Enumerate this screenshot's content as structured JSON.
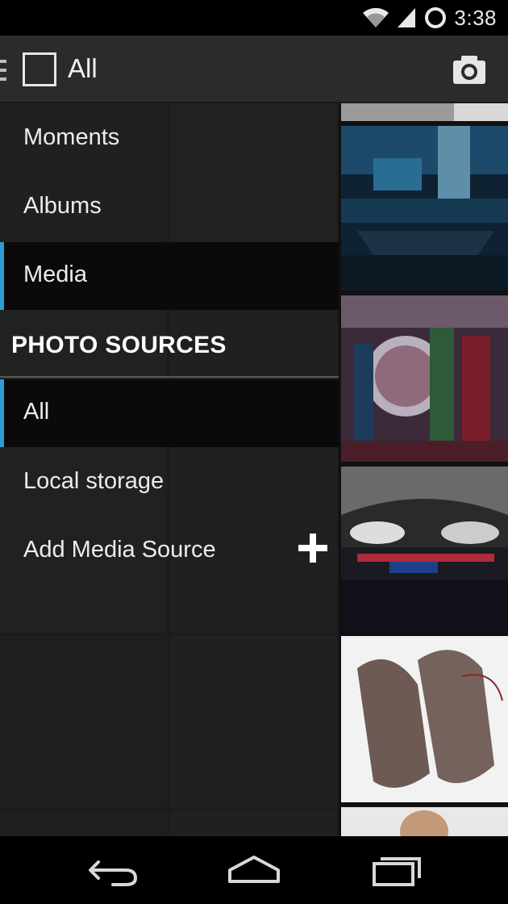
{
  "status_bar": {
    "time": "3:38",
    "icons": [
      "wifi-icon",
      "signal-icon",
      "battery-loading-icon"
    ]
  },
  "action_bar": {
    "title": "All",
    "icons": [
      "menu-icon",
      "app-icon",
      "camera-icon"
    ]
  },
  "drawer": {
    "items": [
      {
        "label": "Moments",
        "selected": false
      },
      {
        "label": "Albums",
        "selected": false
      },
      {
        "label": "Media",
        "selected": true
      }
    ],
    "section_header": "PHOTO SOURCES",
    "sources": [
      {
        "label": "All",
        "selected": true
      },
      {
        "label": "Local storage",
        "selected": false
      },
      {
        "label": "Add Media Source",
        "selected": false,
        "icon": "plus-icon"
      }
    ]
  },
  "colors": {
    "accent": "#2e9bd6",
    "drawer_bg": "#1e1e1e",
    "action_bar": "#2b2b2b"
  },
  "nav_bar": {
    "icons": [
      "back-icon",
      "home-icon",
      "recents-icon"
    ]
  }
}
